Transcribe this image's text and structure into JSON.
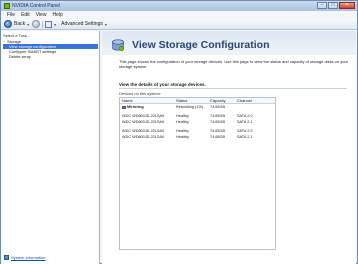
{
  "window": {
    "title": "NVIDIA Control Panel",
    "controls": {
      "minimize": "–",
      "maximize": "□",
      "close": "✕"
    }
  },
  "menu": [
    "File",
    "Edit",
    "View",
    "Help"
  ],
  "toolbar": {
    "back_label": "Back",
    "back_arrow": "▾",
    "home_arrow": "▾",
    "settings_label": "Advanced Settings",
    "settings_arrow": "▾",
    "icons": [
      "back-icon",
      "forward-icon",
      "home-icon"
    ]
  },
  "sidebar": {
    "task_label": "Select a Task...",
    "tree": [
      {
        "label": "Storage",
        "toggle": "−",
        "level": 0,
        "selected": false
      },
      {
        "label": "View storage configuration",
        "level": 1,
        "selected": true
      },
      {
        "label": "Configure SMART settings",
        "level": 1,
        "selected": false
      },
      {
        "label": "Delete array",
        "level": 1,
        "selected": false
      }
    ],
    "system_info": "System Information"
  },
  "main": {
    "title": "View Storage Configuration",
    "intro": "This page shows the configuration of your storage devices. Use this page to view the status and capacity of storage disks on your storage system.",
    "details_heading": "View the details of your storage devices.",
    "devices_label": "Devices on this system:",
    "table": {
      "columns": [
        "Name",
        "Status",
        "Capacity",
        "Channel"
      ],
      "rows": [
        {
          "name": "Mirroring",
          "status": "Rebuilding (1%)",
          "capacity": "74.65GB",
          "channel": "",
          "group": true
        },
        {
          "spacer": true
        },
        {
          "name": "WDC WD800JD-22LSA0",
          "status": "Healthy",
          "capacity": "74.65GB",
          "channel": "SATA 2.0"
        },
        {
          "name": "WDC WD800JD-22LSA0",
          "status": "Healthy",
          "capacity": "74.65GB",
          "channel": "SATA 2.1"
        },
        {
          "spacer": true
        },
        {
          "name": "WDC WD800JD-22LSA0",
          "status": "Healthy",
          "capacity": "74.65GB",
          "channel": "SATA 2.0"
        },
        {
          "name": "WDC WD800JD-22LSA0",
          "status": "Healthy",
          "capacity": "74.65GB",
          "channel": "SATA 2.1"
        }
      ]
    }
  },
  "colors": {
    "accent": "#2a456e",
    "selection": "#3874d6",
    "link": "#1a4c9c",
    "nvidia_green": "#76b900"
  }
}
